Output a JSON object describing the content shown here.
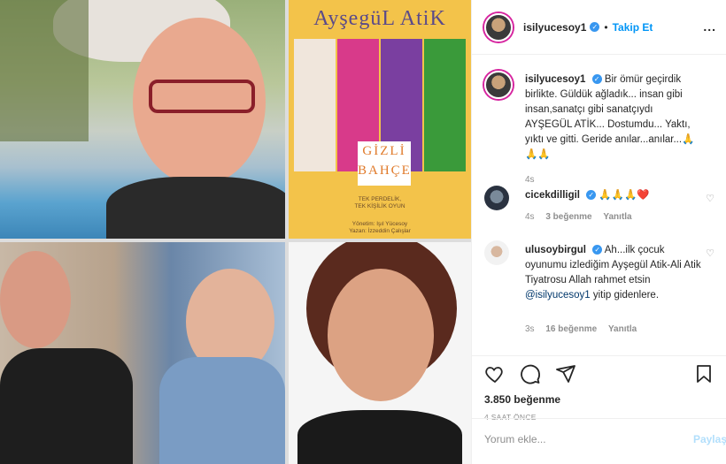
{
  "header": {
    "username": "isilyucesoy1",
    "follow_label": "Takip Et",
    "dot": "•",
    "more": "..."
  },
  "poster": {
    "title": "AyşegüL AtiK",
    "play_line1": "GİZLİ",
    "play_line2": "BAHÇE",
    "sub_line1": "TEK PERDELİK,",
    "sub_line2": "TEK KİŞİLİK OYUN",
    "credit_line1": "Yönetim: Işıl Yücesoy",
    "credit_line2": "Yazan: İzzeddin Çalışlar"
  },
  "caption": {
    "username": "isilyucesoy1",
    "text": "Bir ömür geçirdik birlikte. Güldük ağladık... insan gibi insan,sanatçı gibi sanatçıydı AYŞEGÜL ATİK... Dostumdu... Yaktı, yıktı ve gitti. Geride anılar...anılar...🙏🙏🙏",
    "time": "4s"
  },
  "comments": [
    {
      "username": "cicekdilligil",
      "text": "🙏🙏🙏❤️",
      "time": "4s",
      "likes": "3 beğenme",
      "reply": "Yanıtla"
    },
    {
      "username": "ulusoybirgul",
      "text_before": "Ah...ilk çocuk oyunumu izlediğim Ayşegül Atik-Ali Atik Tiyatrosu Allah rahmet etsin ",
      "mention": "@isilyucesoy1",
      "text_after": " yitip gidenlere.",
      "time": "3s",
      "likes": "16 beğenme",
      "reply": "Yanıtla"
    }
  ],
  "actions": {
    "likes_count": "3.850 beğenme",
    "posted_ago": "4 SAAT ÖNCE"
  },
  "add_comment": {
    "placeholder": "Yorum ekle...",
    "post_label": "Paylaş"
  },
  "colors": {
    "accent": "#0095f6",
    "verified": "#3897f0",
    "muted": "#8e8e8e",
    "heart_red": "#ed4956"
  }
}
